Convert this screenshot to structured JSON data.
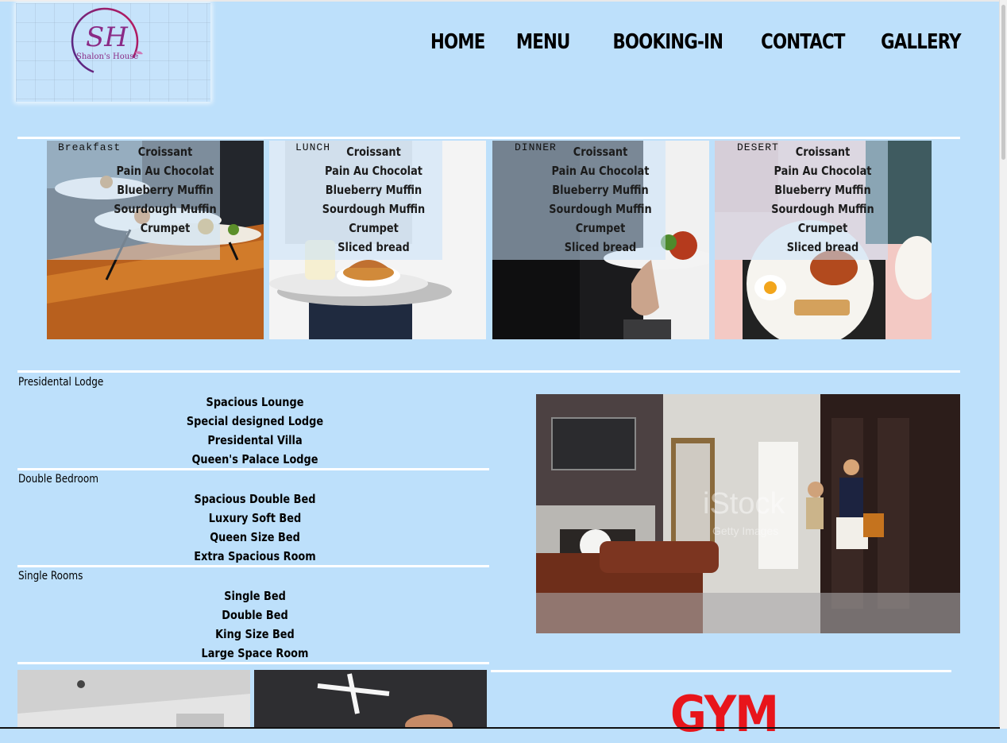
{
  "logo": {
    "initials": "SH",
    "name": "Shalon's House"
  },
  "nav": [
    "HOME",
    "MENU",
    "BOOKING-IN",
    "CONTACT",
    "GALLERY"
  ],
  "menu": [
    {
      "label": "Breakfast",
      "items": [
        "Croissant",
        "Pain Au Chocolat",
        "Blueberry Muffin",
        "Sourdough Muffin",
        "Crumpet"
      ]
    },
    {
      "label": "LUNCH",
      "items": [
        "Croissant",
        "Pain Au Chocolat",
        "Blueberry Muffin",
        "Sourdough Muffin",
        "Crumpet",
        "Sliced bread"
      ]
    },
    {
      "label": "DINNER",
      "items": [
        "Croissant",
        "Pain Au Chocolat",
        "Blueberry Muffin",
        "Sourdough Muffin",
        "Crumpet",
        "Sliced bread"
      ]
    },
    {
      "label": "DESERT",
      "items": [
        "Croissant",
        "Pain Au Chocolat",
        "Blueberry Muffin",
        "Sourdough Muffin",
        "Crumpet",
        "Sliced bread"
      ]
    }
  ],
  "rooms": [
    {
      "title": "Presidental Lodge",
      "items": [
        "Spacious Lounge",
        "Special designed Lodge",
        "Presidental Villa",
        "Queen's Palace Lodge"
      ]
    },
    {
      "title": "Double Bedroom",
      "items": [
        "Spacious Double Bed",
        "Luxury Soft Bed",
        "Queen Size Bed",
        "Extra Spacious Room"
      ]
    },
    {
      "title": "Single Rooms",
      "items": [
        "Single Bed",
        "Double Bed",
        "King Size Bed",
        "Large Space Room"
      ]
    }
  ],
  "watermark": "iStock",
  "watermark_sub": "Getty Images",
  "gym_title": "GYM",
  "colors": {
    "page_bg": "#bde0fb",
    "gym": "#e8151b",
    "logo_purple": "#8a2b86"
  }
}
